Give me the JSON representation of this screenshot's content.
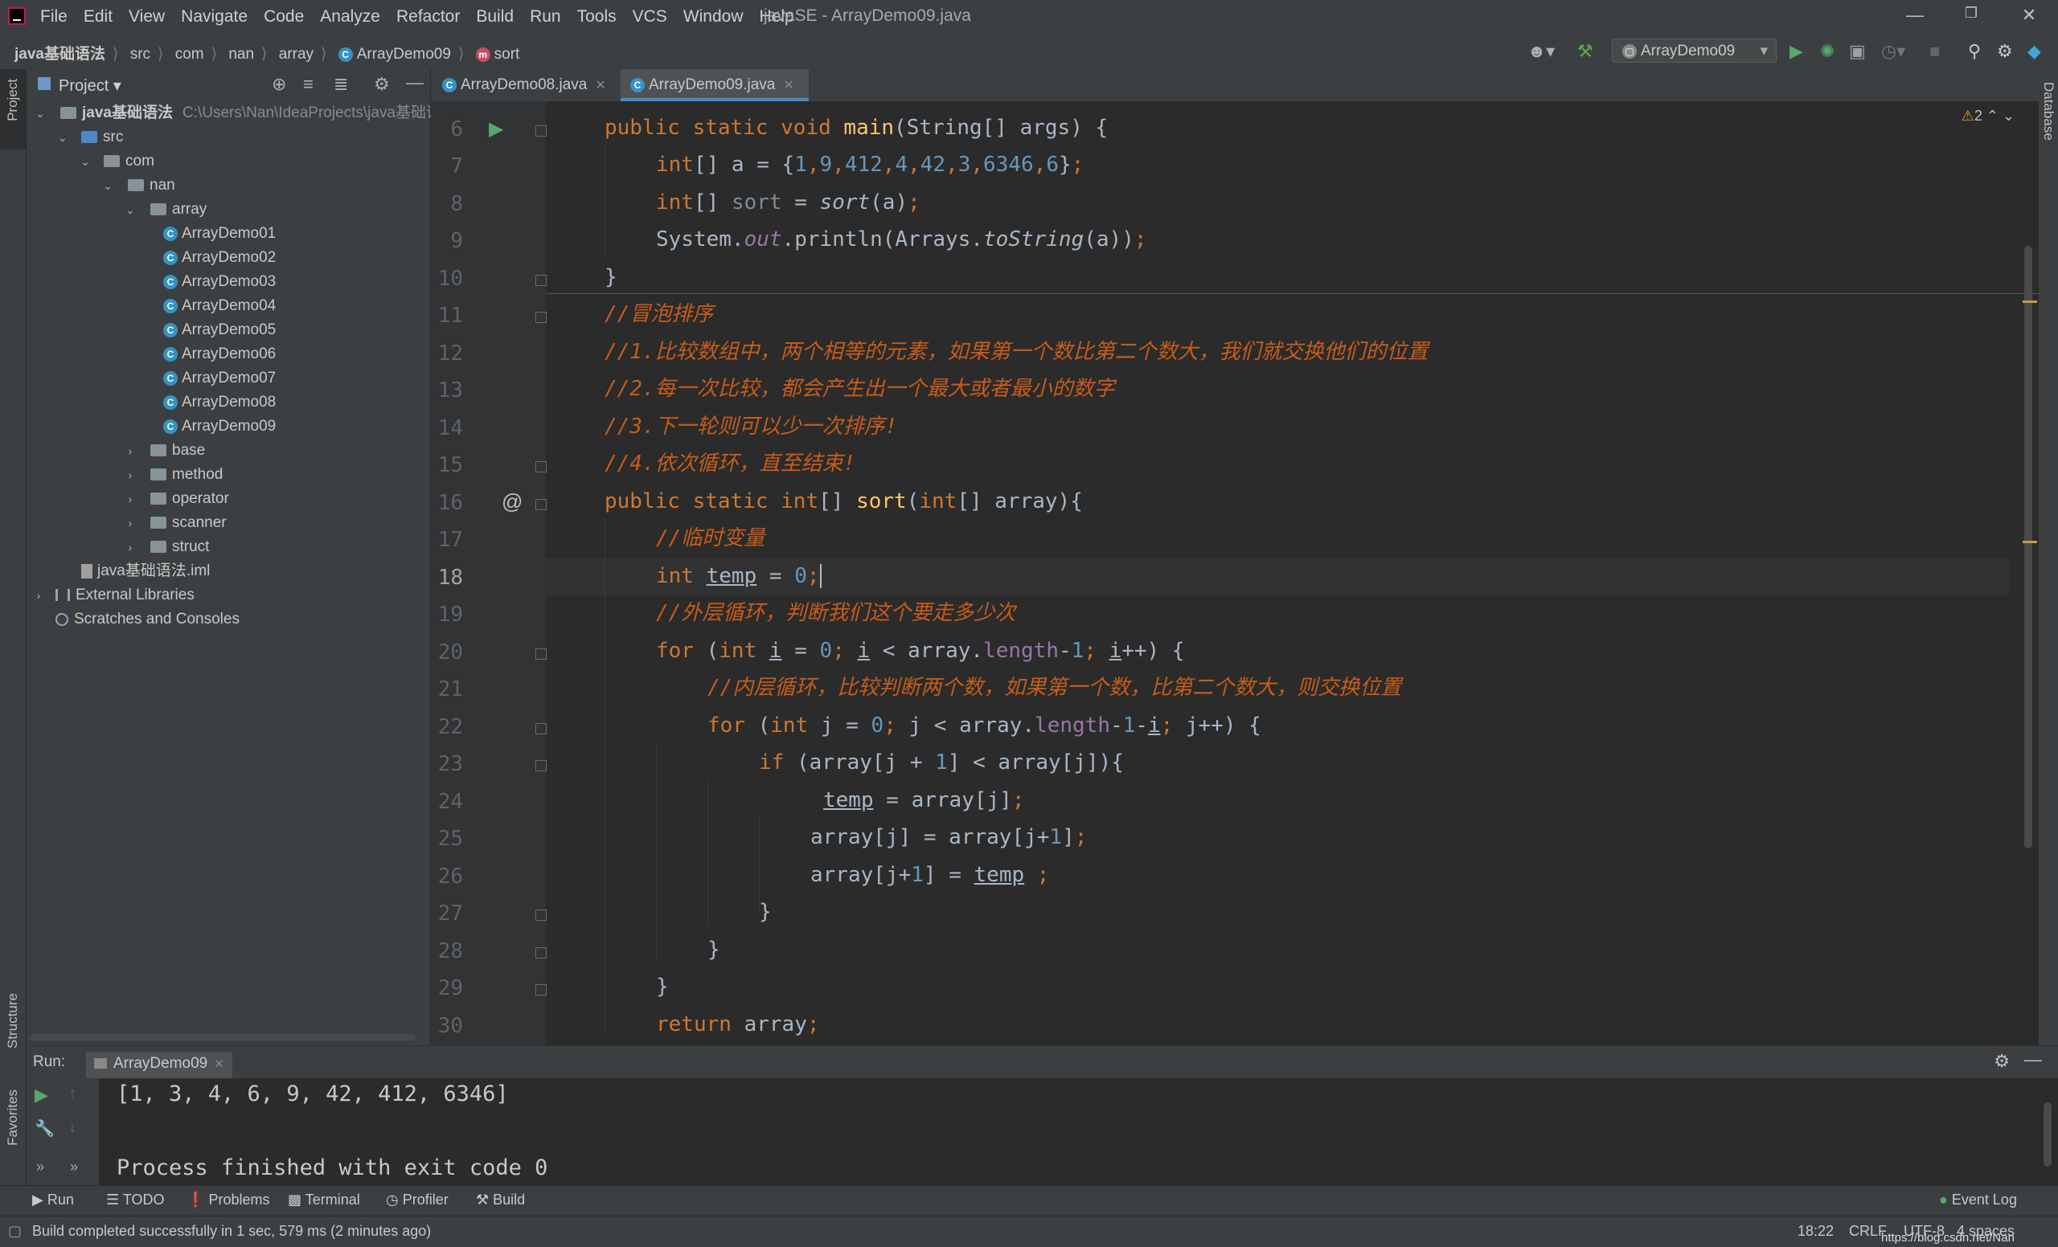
{
  "menubar": {
    "items": [
      "File",
      "Edit",
      "View",
      "Navigate",
      "Code",
      "Analyze",
      "Refactor",
      "Build",
      "Run",
      "Tools",
      "VCS",
      "Window",
      "Help"
    ],
    "title": "javaSE - ArrayDemo09.java"
  },
  "breadcrumb": [
    "java基础语法",
    "src",
    "com",
    "nan",
    "array",
    "ArrayDemo09",
    "sort"
  ],
  "run_config": "ArrayDemo09",
  "project_panel": {
    "title": "Project",
    "root_name": "java基础语法",
    "root_path": "C:\\Users\\Nan\\IdeaProjects\\java基础语",
    "src": "src",
    "com": "com",
    "nan": "nan",
    "array": "array",
    "classes": [
      "ArrayDemo01",
      "ArrayDemo02",
      "ArrayDemo03",
      "ArrayDemo04",
      "ArrayDemo05",
      "ArrayDemo06",
      "ArrayDemo07",
      "ArrayDemo08",
      "ArrayDemo09"
    ],
    "packages": [
      "base",
      "method",
      "operator",
      "scanner",
      "struct"
    ],
    "iml": "java基础语法.iml",
    "external_libraries": "External Libraries",
    "scratches": "Scratches and Consoles"
  },
  "tabs": [
    {
      "label": "ArrayDemo08.java",
      "active": false
    },
    {
      "label": "ArrayDemo09.java",
      "active": true
    }
  ],
  "editor": {
    "warning_count": "2",
    "current_line": 18,
    "line_numbers": [
      "6",
      "7",
      "8",
      "9",
      "10",
      "11",
      "12",
      "13",
      "14",
      "15",
      "16",
      "17",
      "18",
      "19",
      "20",
      "21",
      "22",
      "23",
      "24",
      "25",
      "26",
      "27",
      "28",
      "29",
      "30"
    ],
    "comments": {
      "c11": "//冒泡排序",
      "c12": "//1.比较数组中，两个相等的元素，如果第一个数比第二个数大，我们就交换他们的位置",
      "c13": "//2.每一次比较，都会产生出一个最大或者最小的数字",
      "c14": "//3.下一轮则可以少一次排序!",
      "c15": "//4.依次循环，直至结束!",
      "c17": "//临时变量",
      "c19": "//外层循环，判断我们这个要走多少次",
      "c21": "//内层循环，比较判断两个数，如果第一个数，比第二个数大，则交换位置"
    }
  },
  "run_panel": {
    "label": "Run:",
    "tab": "ArrayDemo09",
    "output": [
      "[1, 3, 4, 6, 9, 42, 412, 6346]",
      "Process finished with exit code 0"
    ]
  },
  "bottom_tools": [
    "Run",
    "TODO",
    "Problems",
    "Terminal",
    "Profiler",
    "Build"
  ],
  "event_log": "Event Log",
  "left_strip": [
    "Project",
    "Structure",
    "Favorites"
  ],
  "right_strip": [
    "Database"
  ],
  "status": {
    "message": "Build completed successfully in 1 sec, 579 ms (2 minutes ago)",
    "position": "18:22",
    "line_sep": "CRLF",
    "encoding": "UTF-8",
    "indent": "4 spaces",
    "watermark": "https://blog.csdn.net/Nan"
  }
}
